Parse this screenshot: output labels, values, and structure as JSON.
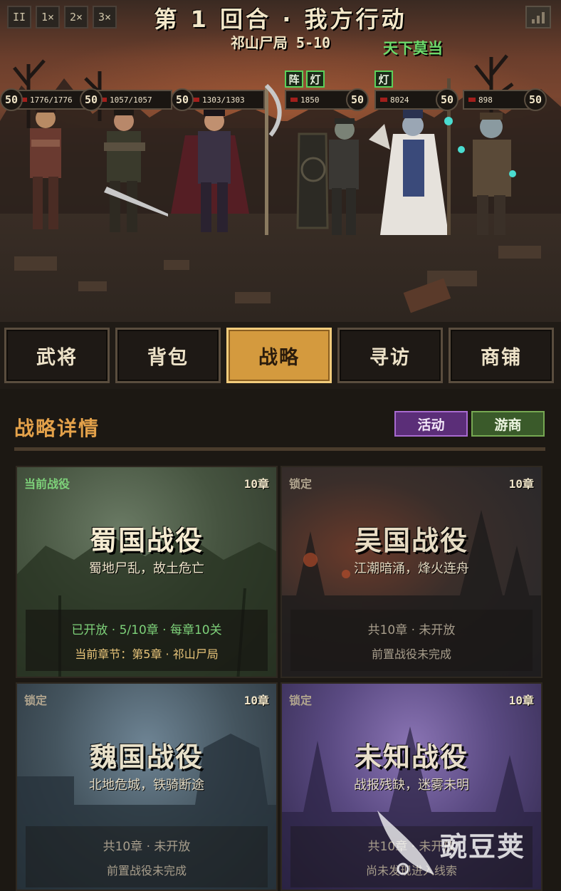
{
  "battle": {
    "speed_buttons": [
      {
        "label": "II",
        "active": true
      },
      {
        "label": "1×",
        "active": false
      },
      {
        "label": "2×",
        "active": false
      },
      {
        "label": "3×",
        "active": false
      }
    ],
    "round_title": "第 1 回合 · 我方行动",
    "stage_label": "祁山尸局 5-10",
    "battle_tag": "天下莫当",
    "allies": [
      {
        "level": "50",
        "hp": "1776/1776",
        "hp_fraction": 1.0
      },
      {
        "level": "50",
        "hp": "1057/1057",
        "hp_fraction": 1.0
      },
      {
        "level": "50",
        "hp": "1303/1303",
        "hp_fraction": 1.0
      }
    ],
    "enemies": [
      {
        "level": "50",
        "hp": "1850",
        "hp_fraction": 1.0,
        "tags": [
          "阵",
          "灯"
        ]
      },
      {
        "level": "50",
        "hp": "8024",
        "hp_fraction": 1.0,
        "tags": [
          "灯"
        ]
      },
      {
        "level": "50",
        "hp": "898",
        "hp_fraction": 1.0,
        "tags": []
      }
    ]
  },
  "tabs": [
    {
      "label": "武将",
      "active": false
    },
    {
      "label": "背包",
      "active": false
    },
    {
      "label": "战略",
      "active": true
    },
    {
      "label": "寻访",
      "active": false
    },
    {
      "label": "商铺",
      "active": false
    }
  ],
  "panel": {
    "title": "战略详情",
    "event_label": "活动",
    "merchant_label": "游商",
    "campaigns": [
      {
        "status": "当前战役",
        "chapters": "10章",
        "title": "蜀国战役",
        "subtitle": "蜀地尸乱，故土危亡",
        "line1": "已开放 · 5/10章 · 每章10关",
        "line2": "当前章节：第5章 · 祁山尸局",
        "locked": false
      },
      {
        "status": "锁定",
        "chapters": "10章",
        "title": "吴国战役",
        "subtitle": "江潮暗涌，烽火连舟",
        "line1": "共10章 · 未开放",
        "line2": "前置战役未完成",
        "locked": true
      },
      {
        "status": "锁定",
        "chapters": "10章",
        "title": "魏国战役",
        "subtitle": "北地危城，铁骑断途",
        "line1": "共10章 · 未开放",
        "line2": "前置战役未完成",
        "locked": true
      },
      {
        "status": "锁定",
        "chapters": "10章",
        "title": "未知战役",
        "subtitle": "战报残缺，迷雾未明",
        "line1": "共10章 · 未开放",
        "line2": "尚未发现进入线索",
        "locked": true
      }
    ]
  },
  "watermark": {
    "text": "豌豆荚"
  },
  "colors": {
    "accent_gold": "#d49a3e",
    "title_orange": "#e3a14a",
    "current_green": "#7ed27a",
    "event_purple": "#5b2e78",
    "merchant_green": "#3a5a2a",
    "hp_red": "#a21f1c"
  }
}
